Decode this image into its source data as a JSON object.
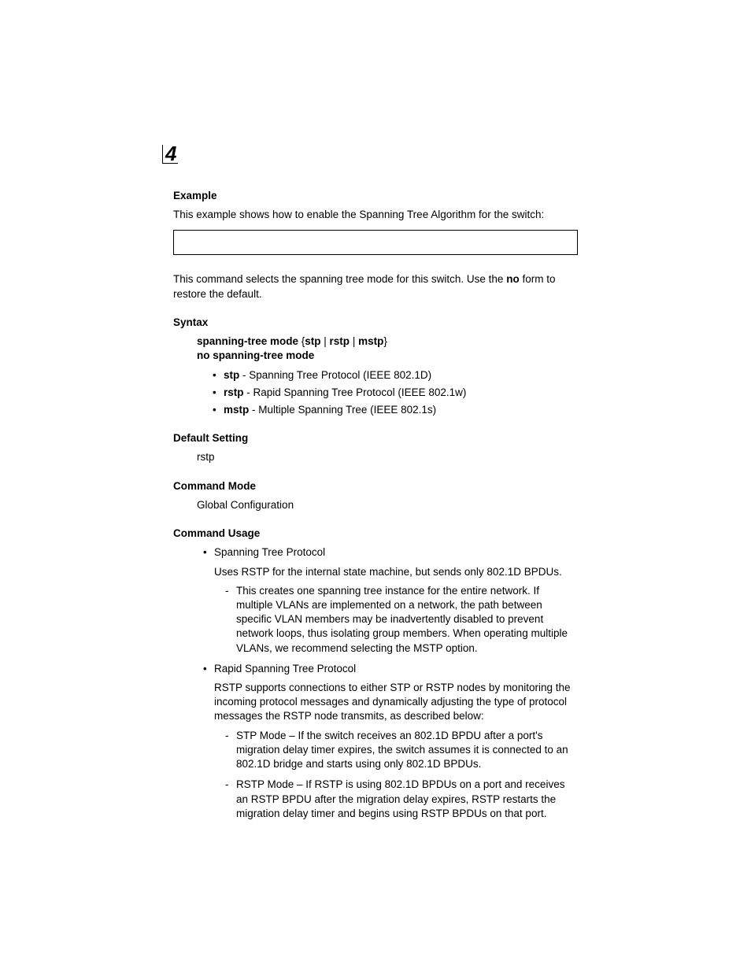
{
  "chapterNumber": "4",
  "example": {
    "heading": "Example",
    "intro": "This example shows how to enable the Spanning Tree Algorithm for the switch:"
  },
  "commandDesc": {
    "pre": "This command selects the spanning tree mode for this switch. Use the ",
    "noBold": "no",
    "post": " form to restore the default."
  },
  "syntax": {
    "heading": "Syntax",
    "line1": {
      "cmd": "spanning-tree mode",
      "open": " {",
      "opt1": "stp",
      "sep1": " | ",
      "opt2": "rstp",
      "sep2": " | ",
      "opt3": "mstp",
      "close": "}"
    },
    "line2": "no spanning-tree mode",
    "options": [
      {
        "name": "stp",
        "desc": " - Spanning Tree Protocol (IEEE 802.1D)"
      },
      {
        "name": "rstp",
        "desc": " - Rapid Spanning Tree Protocol (IEEE 802.1w)"
      },
      {
        "name": "mstp",
        "desc": " - Multiple Spanning Tree (IEEE 802.1s)"
      }
    ]
  },
  "defaultSetting": {
    "heading": "Default Setting",
    "value": "rstp"
  },
  "commandMode": {
    "heading": "Command Mode",
    "value": "Global Configuration"
  },
  "commandUsage": {
    "heading": "Command Usage",
    "items": [
      {
        "title": "Spanning Tree Protocol",
        "desc": "Uses RSTP for the internal state machine, but sends only 802.1D BPDUs.",
        "sub": [
          "This creates one spanning tree instance for the entire network. If multiple VLANs are implemented on a network, the path between specific VLAN members may be inadvertently disabled to prevent network loops, thus isolating group members. When operating multiple VLANs, we recommend selecting the MSTP option."
        ]
      },
      {
        "title": "Rapid Spanning Tree Protocol",
        "desc": "RSTP supports connections to either STP or RSTP nodes by monitoring the incoming protocol messages and dynamically adjusting the type of protocol messages the RSTP node transmits, as described below:",
        "sub": [
          "STP Mode – If the switch receives an 802.1D BPDU after a port's migration delay timer expires, the switch assumes it is connected to an 802.1D bridge and starts using only 802.1D BPDUs.",
          "RSTP Mode – If RSTP is using 802.1D BPDUs on a port and receives an RSTP BPDU after the migration delay expires, RSTP restarts the migration delay timer and begins using RSTP BPDUs on that port."
        ]
      }
    ]
  }
}
